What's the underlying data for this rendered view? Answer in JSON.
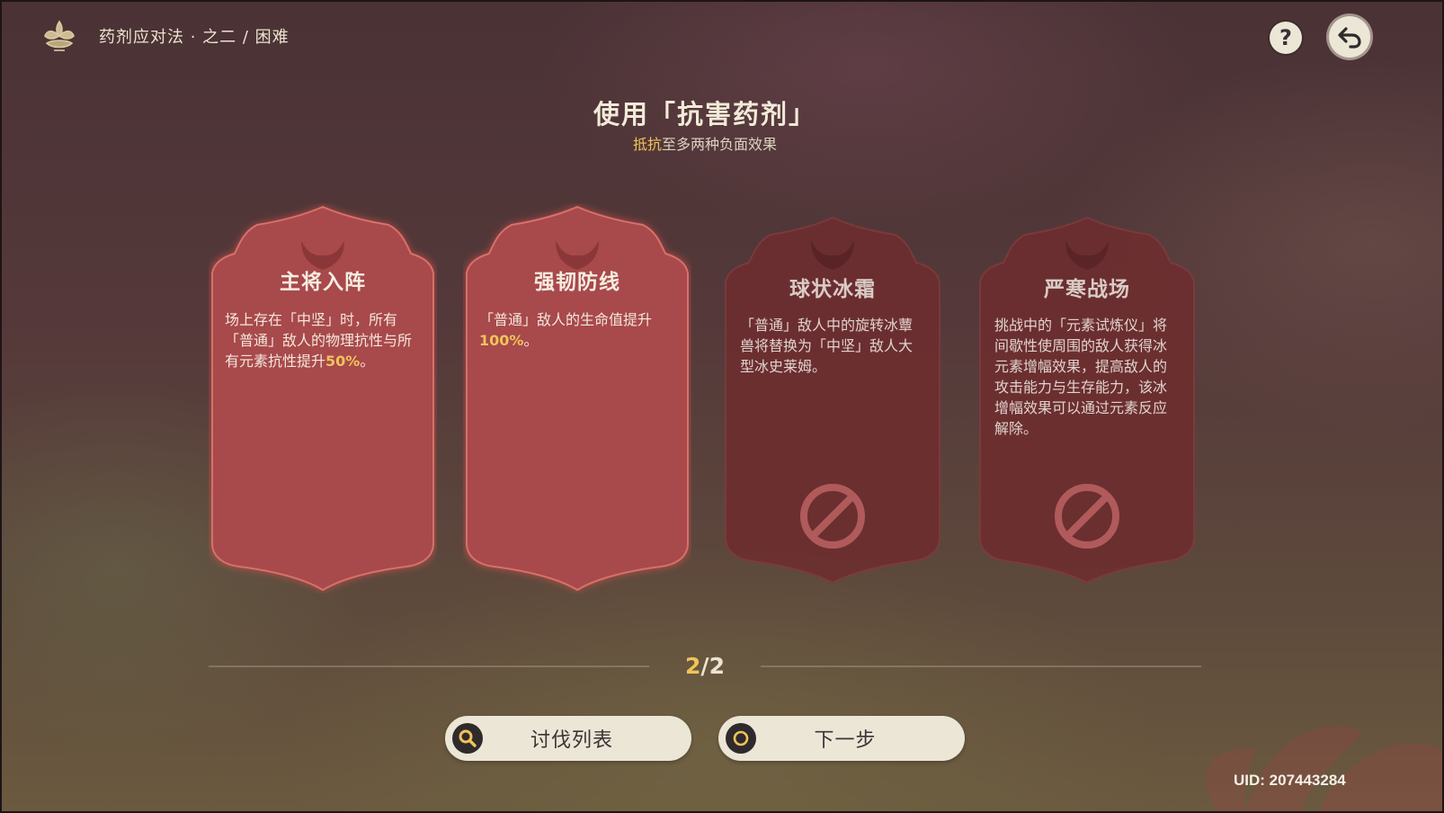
{
  "header": {
    "breadcrumb": "药剂应对法 · 之二 / 困难",
    "help_label": "?"
  },
  "main": {
    "title": "使用「抗害药剂」",
    "subtitle_highlight": "抵抗",
    "subtitle_rest": "至多两种负面效果"
  },
  "cards": [
    {
      "name": "主将入阵",
      "desc_before": "场上存在「中坚」时，所有「普通」敌人的物理抗性与所有元素抗性提升",
      "desc_value": "50%",
      "desc_after": "。",
      "state": "active"
    },
    {
      "name": "强韧防线",
      "desc_before": "「普通」敌人的生命值提升",
      "desc_value": "100%",
      "desc_after": "。",
      "state": "active"
    },
    {
      "name": "球状冰霜",
      "desc_before": "「普通」敌人中的旋转冰蕈兽将替换为「中坚」敌人大型冰史莱姆。",
      "desc_value": "",
      "desc_after": "",
      "state": "disabled"
    },
    {
      "name": "严寒战场",
      "desc_before": "挑战中的「元素试炼仪」将间歇性使周围的敌人获得冰元素增幅效果，提高敌人的攻击能力与生存能力，该冰增幅效果可以通过元素反应解除。",
      "desc_value": "",
      "desc_after": "",
      "state": "disabled"
    }
  ],
  "pager": {
    "current": "2",
    "separator": "/",
    "total": "2"
  },
  "buttons": {
    "list_label": "讨伐列表",
    "next_label": "下一步"
  },
  "uid": "UID: 207443284",
  "colors": {
    "accent_gold": "#f0c35a",
    "active_card": "#a34a4c",
    "disabled_card": "#6a2e30",
    "button_bg": "#ece6d6"
  },
  "icons": [
    "flower-logo-icon",
    "help-icon",
    "back-arrow-icon",
    "demon-horn-emblem-icon",
    "disabled-icon",
    "search-icon",
    "circle-icon"
  ]
}
